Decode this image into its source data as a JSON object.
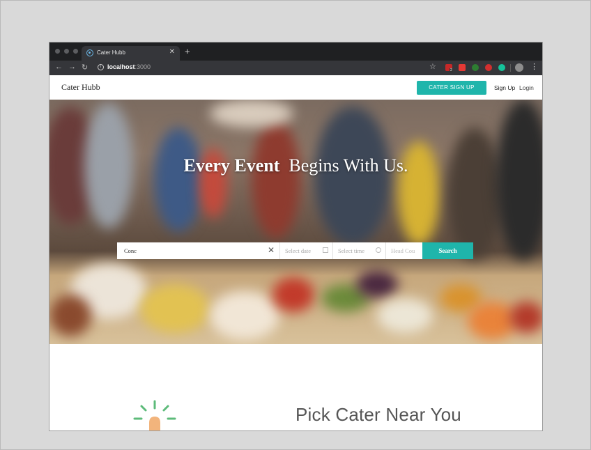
{
  "browser": {
    "tab_title": "Cater Hubb",
    "url_host": "localhost",
    "url_port": ":3000",
    "extension_badge": "2"
  },
  "nav": {
    "brand": "Cater Hubb",
    "cater_signup": "CATER SIGN UP",
    "signup": "Sign Up",
    "login": "Login"
  },
  "hero": {
    "title_bold": "Every Event",
    "title_rest": "Begins With Us."
  },
  "search": {
    "query_value": "Conc",
    "date_placeholder": "Select date",
    "time_placeholder": "Select time",
    "headcount_placeholder": "Head Cou",
    "button_label": "Search"
  },
  "section": {
    "title": "Pick Cater Near You"
  },
  "colors": {
    "accent": "#1fb5ab",
    "chrome_dark": "#35363a"
  }
}
